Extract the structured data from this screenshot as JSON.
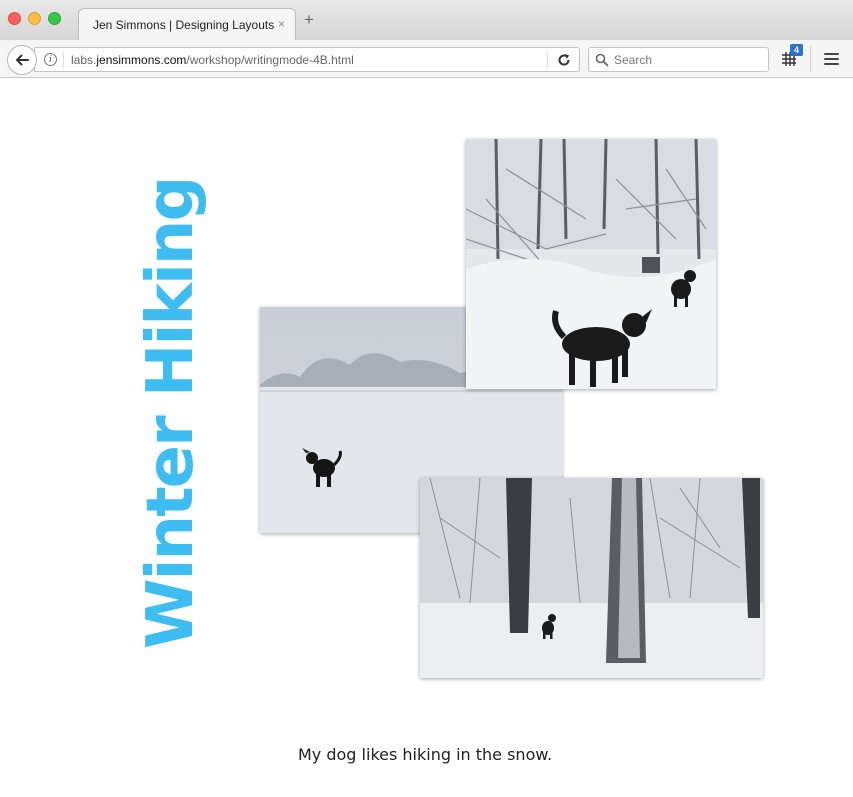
{
  "browser": {
    "tab": {
      "title": "Jen Simmons | Designing Layouts",
      "close_glyph": "×"
    },
    "new_tab_glyph": "+",
    "url": {
      "domain_prefix": "labs.",
      "domain": "jensimmons.com",
      "path": "/workshop/writingmode-4B.html"
    },
    "search": {
      "placeholder": "Search"
    },
    "grid_badge": "4",
    "icons": [
      "back-arrow-icon",
      "info-icon",
      "reload-icon",
      "search-icon",
      "grid-inspector-icon",
      "hamburger-menu-icon"
    ]
  },
  "page": {
    "heading": "Winter Hiking",
    "heading_color": "#3dbdf1",
    "caption": "My dog likes hiking in the snow.",
    "photos": [
      {
        "name": "open-snow-field-with-dog"
      },
      {
        "name": "snowy-woods-two-dogs"
      },
      {
        "name": "snowy-forest-trees-with-dog"
      }
    ]
  }
}
